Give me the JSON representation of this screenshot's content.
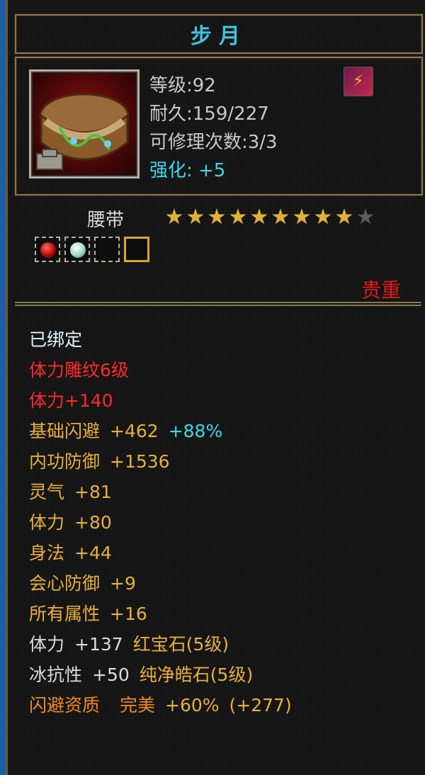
{
  "item": {
    "name": "步月",
    "level_label": "等级:92",
    "durability_label": "耐久:159/227",
    "repair_label": "可修理次数:3/3",
    "enhance_label": "强化: +5",
    "type": "腰带",
    "stars_filled": 9,
    "stars_total": 10,
    "rarity": "贵重"
  },
  "sockets": [
    {
      "gem": "red-gem-icon",
      "filled": true
    },
    {
      "gem": "white-gem-icon",
      "filled": true
    },
    {
      "gem": "",
      "filled": false
    },
    {
      "gem": "",
      "filled": false,
      "highlight": true
    }
  ],
  "attributes": {
    "bound": "已绑定",
    "carving": "体力雕纹6级",
    "carving_bonus": "体力+140",
    "dodge_name": "基础闪避",
    "dodge_value": "+462",
    "dodge_pct": "+88%",
    "inner_def_name": "内功防御",
    "inner_def_value": "+1536",
    "spirit_name": "灵气",
    "spirit_value": "+81",
    "stamina_name": "体力",
    "stamina_value": "+80",
    "agility_name": "身法",
    "agility_value": "+44",
    "crit_def_name": "会心防御",
    "crit_def_value": "+9",
    "all_attr_name": "所有属性",
    "all_attr_value": "+16",
    "gem1_stat": "体力",
    "gem1_value": "+137",
    "gem1_name": "红宝石(5级)",
    "gem2_stat": "冰抗性",
    "gem2_value": "+50",
    "gem2_name": "纯净皓石(5级)",
    "aptitude_name": "闪避资质",
    "aptitude_grade": "完美",
    "aptitude_pct": "+60%",
    "aptitude_bonus": "(+277)"
  },
  "colors": {
    "title": "#3fc3e0",
    "frame": "#8a7650",
    "rarity": "#e81818",
    "red_text": "#ff2a2a",
    "yellow_text": "#e8b03a",
    "cyan_text": "#3fd6ea",
    "orange_text": "#f08a20"
  }
}
